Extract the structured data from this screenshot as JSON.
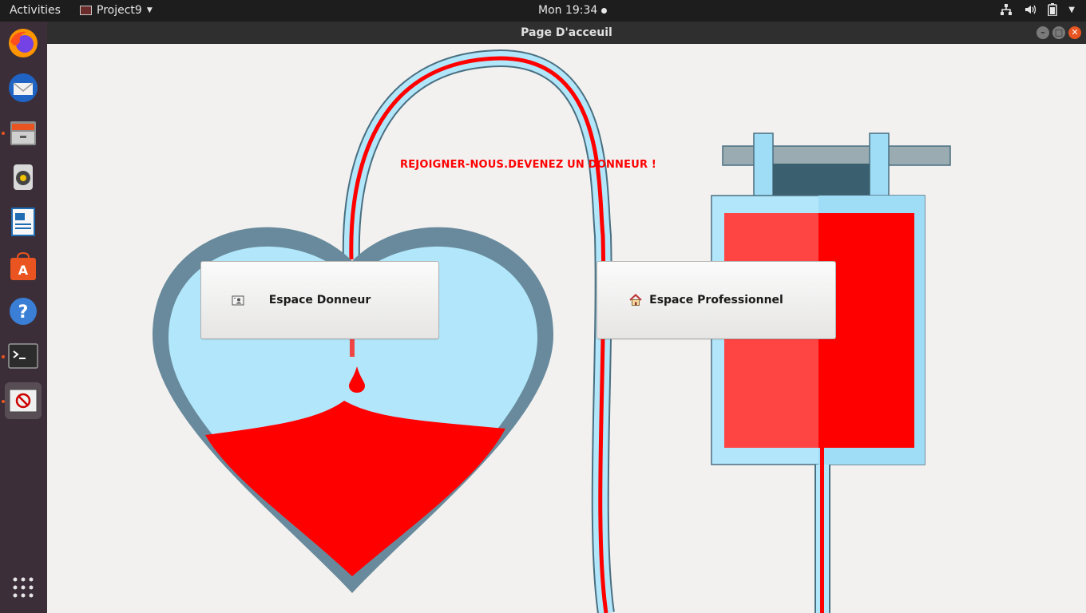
{
  "topbar": {
    "activities": "Activities",
    "app_name": "Project9",
    "clock": "Mon 19:34"
  },
  "dock": {
    "items": [
      {
        "name": "firefox-icon"
      },
      {
        "name": "thunderbird-icon"
      },
      {
        "name": "files-icon"
      },
      {
        "name": "rhythmbox-icon"
      },
      {
        "name": "writer-icon"
      },
      {
        "name": "software-icon"
      },
      {
        "name": "help-icon"
      },
      {
        "name": "terminal-icon"
      },
      {
        "name": "java-app-icon"
      }
    ],
    "apps_grid": "show-applications-icon"
  },
  "window": {
    "title": "Page D'acceuil"
  },
  "main": {
    "tagline": "REJOIGNER-NOUS.DEVENEZ UN DONNEUR !",
    "donor_button": "Espace Donneur",
    "pro_button": "Espace Professionnel"
  },
  "colors": {
    "blood": "#ff0000",
    "light_blue": "#b2e6fa",
    "heart_outline": "#688a9c"
  }
}
